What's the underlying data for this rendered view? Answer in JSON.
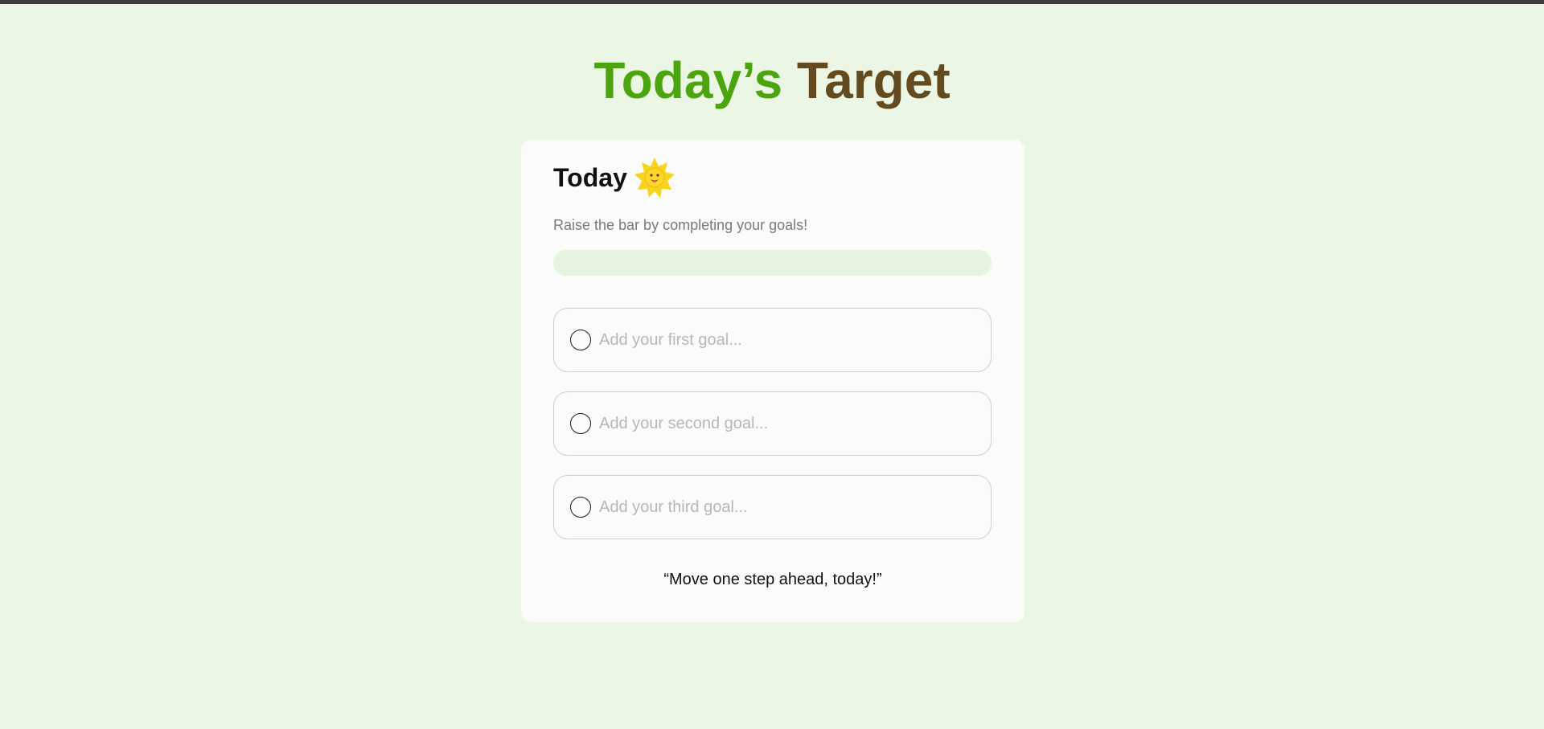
{
  "header": {
    "title_part1": "Today’s",
    "title_part2": "Target",
    "title_color_1": "#4ca40e",
    "title_color_2": "#634b1f"
  },
  "card": {
    "title": "Today",
    "title_icon": "sun-icon",
    "subtitle": "Raise the bar by completing your goals!",
    "progress": 0,
    "goals": [
      {
        "value": "",
        "placeholder": "Add your first goal...",
        "completed": false
      },
      {
        "value": "",
        "placeholder": "Add your second goal...",
        "completed": false
      },
      {
        "value": "",
        "placeholder": "Add your third goal...",
        "completed": false
      }
    ],
    "quote": "“Move one step ahead, today!”"
  },
  "colors": {
    "page_background": "#ebf6e4",
    "card_background": "#fbfbfa",
    "progress_track": "#e7f4df",
    "progress_fill": "#4ca40e"
  }
}
